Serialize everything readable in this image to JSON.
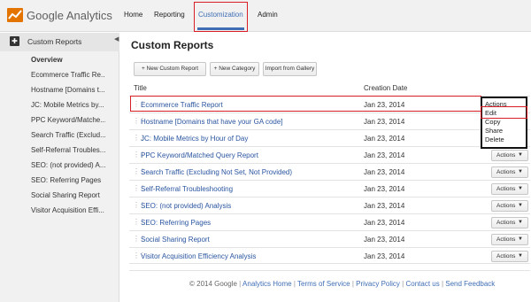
{
  "brand": {
    "name": "Google Analytics"
  },
  "nav": {
    "home": "Home",
    "reporting": "Reporting",
    "customization": "Customization",
    "admin": "Admin"
  },
  "sidebar": {
    "title": "Custom Reports",
    "items": [
      {
        "label": "Overview"
      },
      {
        "label": "Ecommerce Traffic Re..."
      },
      {
        "label": "Hostname [Domains t..."
      },
      {
        "label": "JC: Mobile Metrics by..."
      },
      {
        "label": "PPC Keyword/Matche..."
      },
      {
        "label": "Search Traffic (Exclud..."
      },
      {
        "label": "Self-Referral Troubles..."
      },
      {
        "label": "SEO: (not provided) A..."
      },
      {
        "label": "SEO: Referring Pages"
      },
      {
        "label": "Social Sharing Report"
      },
      {
        "label": "Visitor Acquisition Effi..."
      }
    ]
  },
  "main": {
    "title": "Custom Reports",
    "buttons": {
      "new_report": "+ New Custom Report",
      "new_category": "+ New Category",
      "import": "Import from Gallery"
    },
    "columns": {
      "title": "Title",
      "date": "Creation Date"
    },
    "actions_label": "Actions",
    "rows": [
      {
        "title": "Ecommerce Traffic Report",
        "date": "Jan 23, 2014"
      },
      {
        "title": "Hostname [Domains that have your GA code]",
        "date": "Jan 23, 2014"
      },
      {
        "title": "JC: Mobile Metrics by Hour of Day",
        "date": "Jan 23, 2014"
      },
      {
        "title": "PPC Keyword/Matched Query Report",
        "date": "Jan 23, 2014"
      },
      {
        "title": "Search Traffic (Excluding Not Set, Not Provided)",
        "date": "Jan 23, 2014"
      },
      {
        "title": "Self-Referral Troubleshooting",
        "date": "Jan 23, 2014"
      },
      {
        "title": "SEO: (not provided) Analysis",
        "date": "Jan 23, 2014"
      },
      {
        "title": "SEO: Referring Pages",
        "date": "Jan 23, 2014"
      },
      {
        "title": "Social Sharing Report",
        "date": "Jan 23, 2014"
      },
      {
        "title": "Visitor Acquisition Efficiency Analysis",
        "date": "Jan 23, 2014"
      }
    ],
    "menu": {
      "actions": "Actions",
      "edit": "Edit",
      "copy": "Copy",
      "share": "Share",
      "delete": "Delete"
    }
  },
  "footer": {
    "copyright": "© 2014 Google",
    "links": [
      "Analytics Home",
      "Terms of Service",
      "Privacy Policy",
      "Contact us",
      "Send Feedback"
    ]
  }
}
